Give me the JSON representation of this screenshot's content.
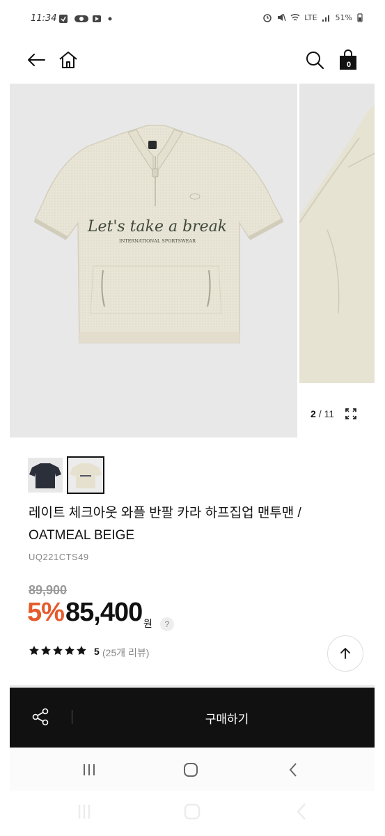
{
  "status_bar": {
    "time": "11:34",
    "network": "LTE",
    "battery": "51%"
  },
  "nav": {
    "back_icon": "arrow-left-icon",
    "home_icon": "home-icon",
    "search_icon": "search-icon",
    "cart_icon": "shopping-bag-icon",
    "cart_count": "0"
  },
  "gallery": {
    "current": "2",
    "total": "11",
    "print_line1": "Let's take a break",
    "print_line2": "INTERNATIONAL SPORTSWEAR"
  },
  "product": {
    "title": "레이트 체크아웃 와플 반팔 카라 하프집업 맨투맨 / OATMEAL BEIGE",
    "code": "UQ221CTS49",
    "original_price": "89,900",
    "discount": "5%",
    "price": "85,400",
    "currency": "원",
    "help": "?",
    "rating": "5",
    "reviews": "(25개 리뷰)",
    "stars": 5
  },
  "buy_bar": {
    "buy_label": "구매하기"
  },
  "colors": {
    "accent": "#e55a2b",
    "shirt": "#e9e5d6",
    "gallery_bg": "#e8e8e8",
    "bar": "#111111"
  }
}
